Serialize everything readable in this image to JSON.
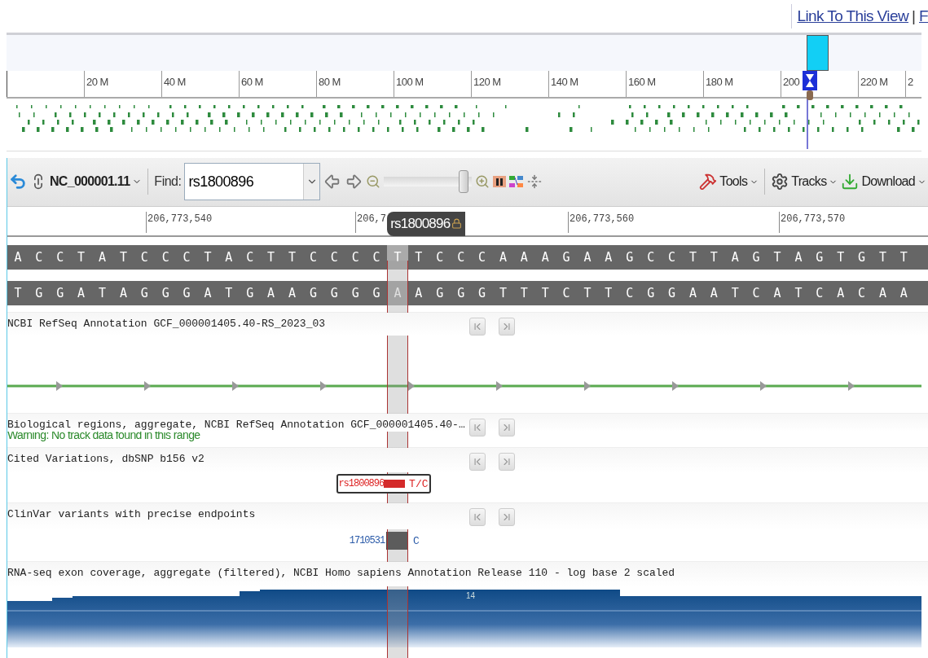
{
  "header_links": {
    "items": [
      "Link To This View",
      "F"
    ],
    "separator": "|"
  },
  "overview": {
    "ticks": [
      "20 M",
      "40 M",
      "60 M",
      "80 M",
      "100 M",
      "120 M",
      "140 M",
      "160 M",
      "180 M",
      "200",
      "220 M",
      "2"
    ]
  },
  "toolbar": {
    "sequence": "NC_000001.11",
    "find_label": "Find:",
    "find_value": "rs1800896",
    "zoom": {
      "level": 0.95
    },
    "menus": [
      "Tools",
      "Tracks",
      "Download"
    ]
  },
  "ruler": {
    "labels": [
      "206,773,540",
      "206,7",
      "206,773,560",
      "206,773,570"
    ],
    "marker": "rs1800896"
  },
  "sequence": [
    {
      "top": "A",
      "bottom": "T",
      "selected": false
    },
    {
      "top": "C",
      "bottom": "G",
      "selected": false
    },
    {
      "top": "C",
      "bottom": "G",
      "selected": false
    },
    {
      "top": "T",
      "bottom": "A",
      "selected": false
    },
    {
      "top": "A",
      "bottom": "T",
      "selected": false
    },
    {
      "top": "T",
      "bottom": "A",
      "selected": false
    },
    {
      "top": "C",
      "bottom": "G",
      "selected": false
    },
    {
      "top": "C",
      "bottom": "G",
      "selected": false
    },
    {
      "top": "C",
      "bottom": "G",
      "selected": false
    },
    {
      "top": "T",
      "bottom": "A",
      "selected": false
    },
    {
      "top": "A",
      "bottom": "T",
      "selected": false
    },
    {
      "top": "C",
      "bottom": "G",
      "selected": false
    },
    {
      "top": "T",
      "bottom": "A",
      "selected": false
    },
    {
      "top": "T",
      "bottom": "A",
      "selected": false
    },
    {
      "top": "C",
      "bottom": "G",
      "selected": false
    },
    {
      "top": "C",
      "bottom": "G",
      "selected": false
    },
    {
      "top": "C",
      "bottom": "G",
      "selected": false
    },
    {
      "top": "C",
      "bottom": "G",
      "selected": false
    },
    {
      "top": "T",
      "bottom": "A",
      "selected": true
    },
    {
      "top": "T",
      "bottom": "A",
      "selected": false
    },
    {
      "top": "C",
      "bottom": "G",
      "selected": false
    },
    {
      "top": "C",
      "bottom": "G",
      "selected": false
    },
    {
      "top": "C",
      "bottom": "G",
      "selected": false
    },
    {
      "top": "A",
      "bottom": "T",
      "selected": false
    },
    {
      "top": "A",
      "bottom": "T",
      "selected": false
    },
    {
      "top": "A",
      "bottom": "T",
      "selected": false
    },
    {
      "top": "G",
      "bottom": "C",
      "selected": false
    },
    {
      "top": "A",
      "bottom": "T",
      "selected": false
    },
    {
      "top": "A",
      "bottom": "T",
      "selected": false
    },
    {
      "top": "G",
      "bottom": "C",
      "selected": false
    },
    {
      "top": "C",
      "bottom": "G",
      "selected": false
    },
    {
      "top": "C",
      "bottom": "G",
      "selected": false
    },
    {
      "top": "T",
      "bottom": "A",
      "selected": false
    },
    {
      "top": "T",
      "bottom": "A",
      "selected": false
    },
    {
      "top": "A",
      "bottom": "T",
      "selected": false
    },
    {
      "top": "G",
      "bottom": "C",
      "selected": false
    },
    {
      "top": "T",
      "bottom": "A",
      "selected": false
    },
    {
      "top": "A",
      "bottom": "T",
      "selected": false
    },
    {
      "top": "G",
      "bottom": "C",
      "selected": false
    },
    {
      "top": "T",
      "bottom": "A",
      "selected": false
    },
    {
      "top": "G",
      "bottom": "C",
      "selected": false
    },
    {
      "top": "T",
      "bottom": "A",
      "selected": false
    },
    {
      "top": "T",
      "bottom": "A",
      "selected": false
    }
  ],
  "tracks": [
    {
      "kind": "gene",
      "title": "NCBI RefSeq Annotation GCF_000001405.40-RS_2023_03",
      "nav_buttons": true
    },
    {
      "kind": "empty",
      "title": "Biological regions, aggregate, NCBI RefSeq Annotation GCF_000001405.40-…",
      "warning": "Warning: No track data found in this range",
      "nav_buttons": true
    },
    {
      "kind": "variant",
      "title": "Cited Variations, dbSNP b156 v2",
      "feature": {
        "label": "rs1800896",
        "allele": "T/C"
      },
      "nav_buttons": true
    },
    {
      "kind": "clinvar",
      "title": "ClinVar variants with precise endpoints",
      "feature": {
        "label": "1710531",
        "allele": "C"
      },
      "nav_buttons": true
    },
    {
      "kind": "coverage",
      "title": "RNA-seq exon coverage, aggregate (filtered), NCBI Homo sapiens Annotation Release 110 - log base 2 scaled",
      "peak_label": "14",
      "nav_buttons": false
    }
  ]
}
